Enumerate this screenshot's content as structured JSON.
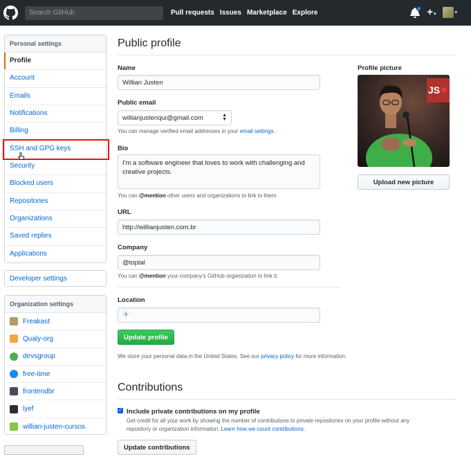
{
  "header": {
    "search_placeholder": "Search GitHub",
    "nav": [
      "Pull requests",
      "Issues",
      "Marketplace",
      "Explore"
    ]
  },
  "sidebar": {
    "personal_heading": "Personal settings",
    "items": [
      {
        "label": "Profile",
        "selected": true
      },
      {
        "label": "Account"
      },
      {
        "label": "Emails"
      },
      {
        "label": "Notifications"
      },
      {
        "label": "Billing"
      },
      {
        "label": "SSH and GPG keys"
      },
      {
        "label": "Security"
      },
      {
        "label": "Blocked users"
      },
      {
        "label": "Repositories"
      },
      {
        "label": "Organizations"
      },
      {
        "label": "Saved replies"
      },
      {
        "label": "Applications"
      }
    ],
    "developer_settings": "Developer settings",
    "org_heading": "Organization settings",
    "orgs": [
      {
        "label": "Freakast",
        "color": "#b59a6a"
      },
      {
        "label": "Qualy-org",
        "color": "#f2a93b"
      },
      {
        "label": "devsgroup",
        "color": "#4caf50"
      },
      {
        "label": "free-time",
        "color": "#1e88e5"
      },
      {
        "label": "frontendbr",
        "color": "#444d56"
      },
      {
        "label": "lyef",
        "color": "#2e2e2e"
      },
      {
        "label": "willian-justen-cursos",
        "color": "#8bc34a"
      }
    ]
  },
  "profile": {
    "title": "Public profile",
    "name_label": "Name",
    "name_value": "Willian Justen",
    "email_label": "Public email",
    "email_value": "willianjustenqui@gmail.com",
    "email_note_pre": "You can manage verified email addresses in your ",
    "email_note_link": "email settings",
    "email_note_post": ".",
    "bio_label": "Bio",
    "bio_value": "I'm a software engineer that loves to work with challenging and creative projects.",
    "bio_note_pre": "You can ",
    "bio_note_mention": "@mention",
    "bio_note_post": " other users and organizations to link to them.",
    "url_label": "URL",
    "url_value": "http://willianjusten.com.br",
    "company_label": "Company",
    "company_value": "@toptal",
    "company_note_pre": "You can ",
    "company_note_mention": "@mention",
    "company_note_post": " your company's GitHub organization to link it.",
    "location_label": "Location",
    "location_value": "✈",
    "update_button": "Update profile",
    "privacy_pre": "We store your personal data in the United States. See our ",
    "privacy_link": "privacy policy",
    "privacy_post": " for more information.",
    "picture_label": "Profile picture",
    "upload_button": "Upload new picture"
  },
  "contributions": {
    "title": "Contributions",
    "checkbox_label": "Include private contributions on my profile",
    "checkbox_checked": true,
    "desc_line1": "Get credit for all your work by showing the number of contributions to private repositories on your profile without any",
    "desc_line2_pre": "repository or organization information. ",
    "desc_link": "Learn how we count contributions",
    "desc_line2_post": ".",
    "update_button": "Update contributions"
  }
}
